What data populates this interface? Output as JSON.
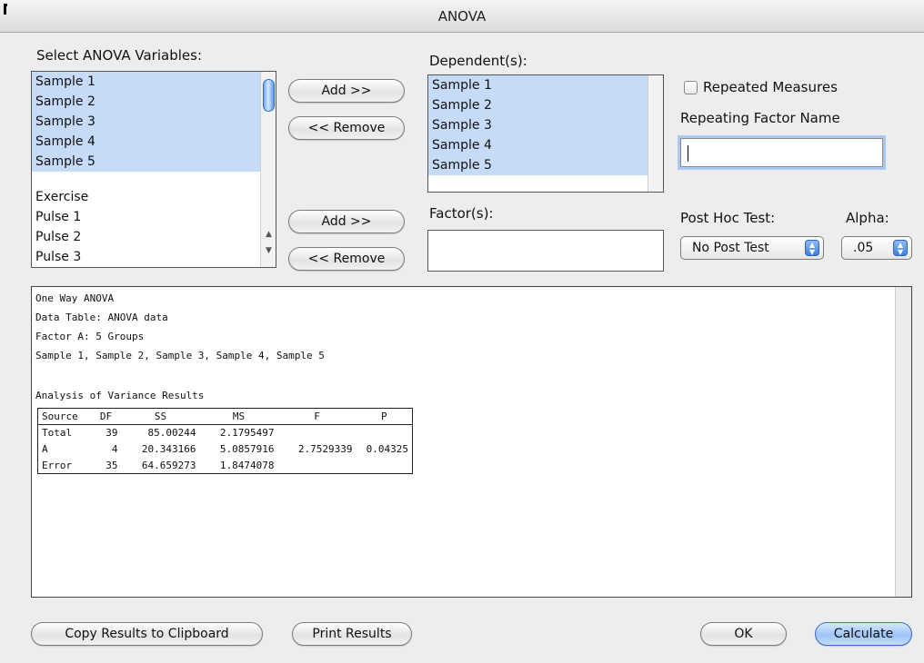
{
  "window": {
    "title": "ANOVA"
  },
  "variables": {
    "label": "Select ANOVA Variables:",
    "items": [
      "Sample 1",
      "Sample 2",
      "Sample 3",
      "Sample 4",
      "Sample 5",
      "",
      "Exercise",
      "Pulse 1",
      "Pulse 2",
      "Pulse 3"
    ],
    "selected_count": 5
  },
  "buttons": {
    "add_dependent": "Add >>",
    "remove_dependent": "<< Remove",
    "add_factor": "Add >>",
    "remove_factor": "<< Remove",
    "copy_results": "Copy Results to Clipboard",
    "print_results": "Print Results",
    "ok": "OK",
    "calculate": "Calculate"
  },
  "dependents": {
    "label": "Dependent(s):",
    "items": [
      "Sample 1",
      "Sample 2",
      "Sample 3",
      "Sample 4",
      "Sample 5"
    ]
  },
  "factors": {
    "label": "Factor(s):",
    "items": []
  },
  "repeated": {
    "checkbox_label": "Repeated Measures",
    "checked": false,
    "factor_name_label": "Repeating Factor Name",
    "factor_name_value": ""
  },
  "post_hoc": {
    "label": "Post Hoc Test:",
    "value": "No Post Test"
  },
  "alpha": {
    "label": "Alpha:",
    "value": ".05"
  },
  "results": {
    "lines": [
      "One Way ANOVA",
      "Data Table: ANOVA data",
      "Factor A: 5 Groups",
      "Sample 1, Sample 2, Sample 3, Sample 4, Sample 5"
    ],
    "table_title": "Analysis of Variance Results",
    "table": {
      "headers": [
        "Source",
        "DF",
        "SS",
        "MS",
        "F",
        "P"
      ],
      "rows": [
        [
          "Total",
          "39",
          "85.00244",
          "2.1795497",
          "",
          ""
        ],
        [
          "A",
          "4",
          "20.343166",
          "5.0857916",
          "2.7529339",
          "0.04325"
        ],
        [
          "Error",
          "35",
          "64.659273",
          "1.8474078",
          "",
          ""
        ]
      ]
    }
  },
  "colors": {
    "selection": "#c5dbf7",
    "accent": "#3d7fe0",
    "window_bg": "#ededed"
  }
}
